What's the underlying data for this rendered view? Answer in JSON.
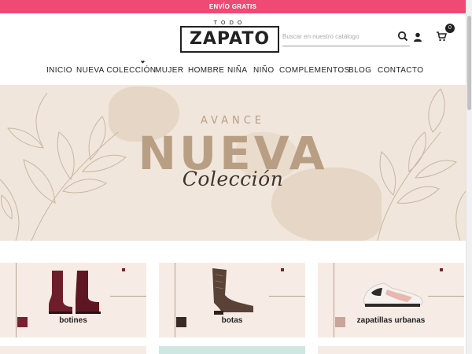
{
  "topbar": {
    "text": "ENVÍO GRATIS"
  },
  "header": {
    "logo_small": "TODO",
    "logo_main": "ZAPATO",
    "search_placeholder": "Buscar en nuestro catálogo",
    "cart_count": "0"
  },
  "nav": {
    "items": [
      {
        "label": "INICIO"
      },
      {
        "label": "NUEVA COLECCIÓN"
      },
      {
        "label": "MUJER"
      },
      {
        "label": "HOMBRE"
      },
      {
        "label": "NIÑA"
      },
      {
        "label": "NIÑO"
      },
      {
        "label": "COMPLEMENTOS"
      },
      {
        "label": "BLOG"
      },
      {
        "label": "CONTACTO"
      }
    ]
  },
  "hero": {
    "line1": "AVANCE",
    "line2": "NUEVA",
    "line3": "Colección"
  },
  "categories": [
    {
      "label": "botines"
    },
    {
      "label": "botas"
    },
    {
      "label": "zapatillas urbanas"
    }
  ],
  "colors": {
    "topbar": "#ef4a74",
    "hero_bg": "#f0e6db",
    "hero_text": "#b89f84"
  }
}
